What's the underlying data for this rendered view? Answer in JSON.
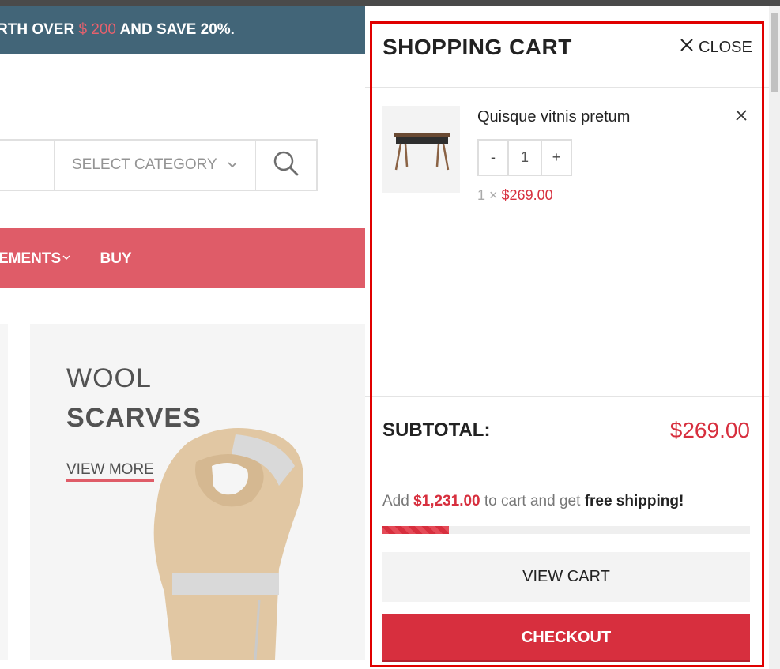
{
  "page": {
    "promo": {
      "prefix": "RTH OVER ",
      "amount": "$ 200",
      "suffix": " AND SAVE 20%."
    },
    "search": {
      "category_label": "SELECT CATEGORY"
    },
    "nav": {
      "items": [
        {
          "label": "EMENTS"
        },
        {
          "label": "BUY"
        }
      ]
    },
    "banner": {
      "kicker": "WOOL",
      "title": "SCARVES",
      "link": "VIEW MORE"
    }
  },
  "cart": {
    "title": "SHOPPING CART",
    "close_label": "CLOSE",
    "items": [
      {
        "name": "Quisque vitnis pretum",
        "quantity": "1",
        "qty_minus": "-",
        "qty_plus": "+",
        "qty_prefix": "1 × ",
        "price": "$269.00"
      }
    ],
    "subtotal_label": "SUBTOTAL:",
    "subtotal_value": "$269.00",
    "shipping": {
      "prefix": "Add ",
      "amount": "$1,231.00",
      "middle": " to cart and get ",
      "free": "free shipping!",
      "progress_fraction": 0.18
    },
    "view_cart_label": "VIEW CART",
    "checkout_label": "CHECKOUT"
  },
  "colors": {
    "accent": "#d72f3e",
    "promo_bg": "#0e3a52",
    "highlight": "#e00000"
  },
  "icons": {
    "close": "close-icon",
    "remove": "remove-item-icon",
    "search": "search-icon",
    "chevron": "chevron-down-icon"
  }
}
